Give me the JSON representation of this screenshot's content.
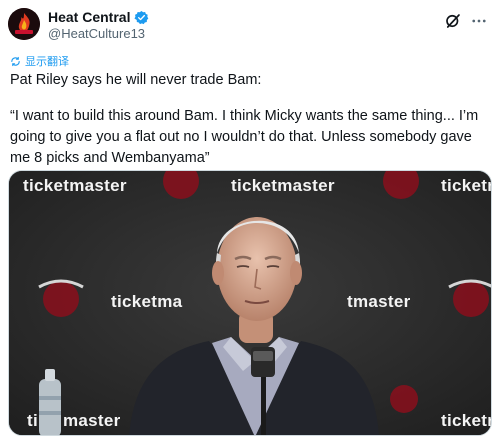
{
  "author": {
    "display_name": "Heat Central",
    "handle": "@HeatCulture13",
    "verified": true
  },
  "actions": {
    "grok_icon": "grok-icon",
    "more_icon": "more-icon"
  },
  "translate": {
    "label": "显示翻译",
    "icon": "translate-icon"
  },
  "tweet": {
    "line1": "Pat Riley says he will never trade Bam:",
    "line2": "“I want to build this around Bam. I think Micky wants the same thing... I’m going to give you a flat out no I wouldn’t do that. Unless somebody gave me 8 picks and Wembanyama”"
  },
  "media": {
    "backdrop_text": "ticketmaster",
    "backdrop_text_partial_right": "ticketm",
    "backdrop_text_mid_left": "ticketma",
    "backdrop_text_mid_right": "tmaster",
    "backdrop_text_bottom_left": "ti",
    "backdrop_text_bottom_mid": "master",
    "backdrop_text_bottom_right": "ticketm"
  },
  "colors": {
    "accent": "#1d9bf0",
    "heat_red": "#c8102e",
    "backdrop": "#262626"
  }
}
